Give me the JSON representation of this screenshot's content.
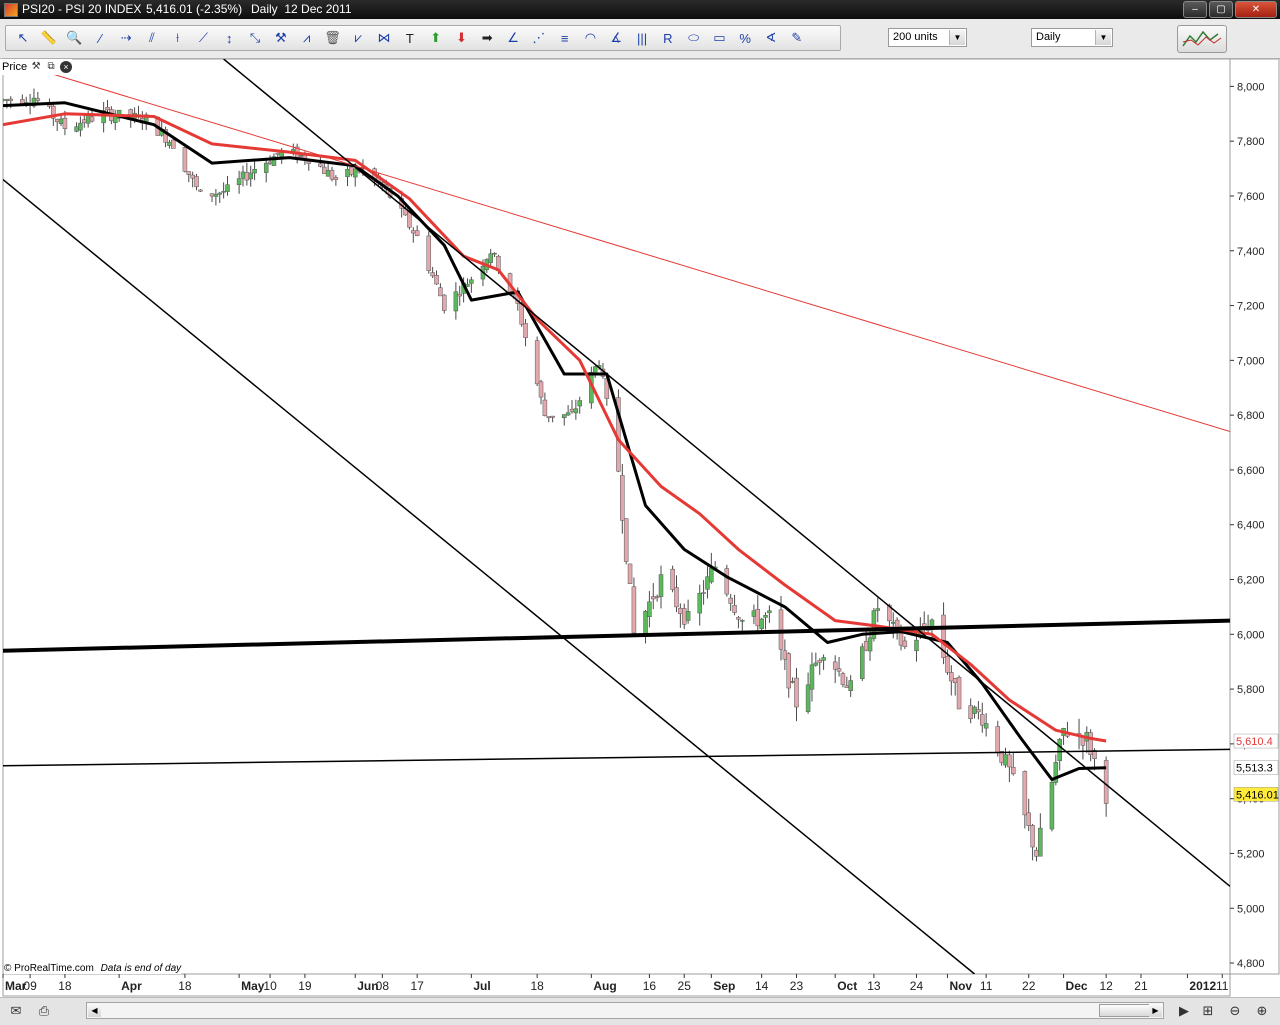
{
  "window": {
    "title_symbol": "PSI20 - PSI 20 INDEX",
    "title_price": "5,416.01 (-2.35%)",
    "title_period": "Daily  12 Dec 2011",
    "btn_minimize": "–",
    "btn_maximize": "▢",
    "btn_close": "✕"
  },
  "toolbar": {
    "tools": [
      {
        "icon": "pointer-icon",
        "glyph": "↖"
      },
      {
        "icon": "ruler-icon",
        "glyph": "📏"
      },
      {
        "icon": "zoom-icon",
        "glyph": "🔍"
      },
      {
        "icon": "line-icon",
        "glyph": "⁄"
      },
      {
        "icon": "horizontal-line-icon",
        "glyph": "⇢"
      },
      {
        "icon": "parallel-lines-icon",
        "glyph": "⫽"
      },
      {
        "icon": "vertical-line-icon",
        "glyph": "⟊"
      },
      {
        "icon": "trendline-icon",
        "glyph": "⟋"
      },
      {
        "icon": "vertical-arrow-icon",
        "glyph": "↕"
      },
      {
        "icon": "arrows-icon",
        "glyph": "⤡"
      },
      {
        "icon": "pitchfork-icon",
        "glyph": "⚒"
      },
      {
        "icon": "regression-icon",
        "glyph": "⩘"
      },
      {
        "icon": "trash-icon",
        "glyph": "🗑"
      },
      {
        "icon": "zigzag-icon",
        "glyph": "⩗"
      },
      {
        "icon": "triangles-icon",
        "glyph": "⋈"
      },
      {
        "icon": "text-icon",
        "glyph": "T"
      },
      {
        "icon": "up-arrow-icon",
        "glyph": "⬆"
      },
      {
        "icon": "down-arrow-icon",
        "glyph": "⬇"
      },
      {
        "icon": "right-arrow-icon",
        "glyph": "➡"
      },
      {
        "icon": "fan-6-icon",
        "glyph": "∠"
      },
      {
        "icon": "fan-icon",
        "glyph": "⋰"
      },
      {
        "icon": "fib-retracement-icon",
        "glyph": "≡"
      },
      {
        "icon": "fib-arc-icon",
        "glyph": "◠"
      },
      {
        "icon": "gann-icon",
        "glyph": "∡"
      },
      {
        "icon": "fib-time-icon",
        "glyph": "|||"
      },
      {
        "icon": "raff-channel-icon",
        "glyph": "R"
      },
      {
        "icon": "ellipse-icon",
        "glyph": "⬭"
      },
      {
        "icon": "rectangle-icon",
        "glyph": "▭"
      },
      {
        "icon": "percent-icon",
        "glyph": "%"
      },
      {
        "icon": "angle-icon",
        "glyph": "∢"
      },
      {
        "icon": "pencil-icon",
        "glyph": "✎"
      }
    ],
    "units_value": "200 units",
    "period_value": "Daily"
  },
  "panel": {
    "label": "Price",
    "wrench_glyph": "⚒",
    "copy_glyph": "⧉",
    "close_glyph": "×"
  },
  "footer": {
    "copyright": "© ProRealTime.com",
    "note": "Data is end of day"
  },
  "colors": {
    "up_candle": "#5cb85c",
    "down_candle": "#e3a8ad",
    "sma_fast": "#000000",
    "sma_slow": "#e53935",
    "last_price_bg": "#ffeb3b",
    "sma_slow_label": "#e53935"
  },
  "bottom": {
    "prev_glyph": "◀",
    "next_glyph": "▶",
    "mail_glyph": "✉",
    "print_glyph": "⎙",
    "zoom_fit_glyph": "⊞",
    "zoom_out_glyph": "⊖",
    "zoom_in_glyph": "⊕"
  },
  "chart_data": {
    "type": "candlestick",
    "symbol": "PSI20",
    "period": "Daily",
    "y_axis": {
      "ylim": [
        4760,
        8100
      ],
      "ticks": [
        "8,000",
        "7,800",
        "7,600",
        "7,400",
        "7,200",
        "7,000",
        "6,800",
        "6,600",
        "6,400",
        "6,200",
        "6,000",
        "5,800",
        "5,600",
        "5,400",
        "5,200",
        "5,000",
        "4,800"
      ],
      "tick_values": [
        8000,
        7800,
        7600,
        7400,
        7200,
        7000,
        6800,
        6600,
        6400,
        6200,
        6000,
        5800,
        5600,
        5400,
        5200,
        5000,
        4800
      ]
    },
    "price_labels": [
      {
        "text": "5,610.4",
        "value": 5610.4,
        "kind": "sma_slow"
      },
      {
        "text": "5,513.3",
        "value": 5513.3,
        "kind": "sma_fast"
      },
      {
        "text": "5,416.01",
        "value": 5416.01,
        "kind": "last"
      }
    ],
    "x_axis": {
      "start_date": "2011-03-02",
      "end_date": "2012-01-13",
      "ticks": [
        {
          "label": "Mar",
          "date": "2011-03-02",
          "major": true
        },
        {
          "label": "09",
          "date": "2011-03-09"
        },
        {
          "label": "18",
          "date": "2011-03-18"
        },
        {
          "label": "Apr",
          "date": "2011-04-01",
          "major": true
        },
        {
          "label": "18",
          "date": "2011-04-18"
        },
        {
          "label": "May",
          "date": "2011-05-02",
          "major": true
        },
        {
          "label": "10",
          "date": "2011-05-10"
        },
        {
          "label": "19",
          "date": "2011-05-19"
        },
        {
          "label": "Jun",
          "date": "2011-06-01",
          "major": true
        },
        {
          "label": "08",
          "date": "2011-06-08"
        },
        {
          "label": "17",
          "date": "2011-06-17"
        },
        {
          "label": "Jul",
          "date": "2011-07-01",
          "major": true
        },
        {
          "label": "18",
          "date": "2011-07-18"
        },
        {
          "label": "Aug",
          "date": "2011-08-01",
          "major": true
        },
        {
          "label": "16",
          "date": "2011-08-16"
        },
        {
          "label": "25",
          "date": "2011-08-25"
        },
        {
          "label": "Sep",
          "date": "2011-09-01",
          "major": true
        },
        {
          "label": "14",
          "date": "2011-09-14"
        },
        {
          "label": "23",
          "date": "2011-09-23"
        },
        {
          "label": "Oct",
          "date": "2011-10-03",
          "major": true
        },
        {
          "label": "13",
          "date": "2011-10-13"
        },
        {
          "label": "24",
          "date": "2011-10-24"
        },
        {
          "label": "Nov",
          "date": "2011-11-01",
          "major": true
        },
        {
          "label": "11",
          "date": "2011-11-11"
        },
        {
          "label": "22",
          "date": "2011-11-22"
        },
        {
          "label": "Dec",
          "date": "2011-12-01",
          "major": true
        },
        {
          "label": "12",
          "date": "2011-12-12"
        },
        {
          "label": "21",
          "date": "2011-12-21"
        },
        {
          "label": "2012",
          "date": "2012-01-02",
          "major": true
        },
        {
          "label": "11",
          "date": "2012-01-11"
        }
      ]
    },
    "price_path": [
      [
        "2011-03-02",
        7950
      ],
      [
        "2011-03-10",
        7960
      ],
      [
        "2011-03-18",
        7850
      ],
      [
        "2011-03-28",
        7900
      ],
      [
        "2011-04-08",
        7880
      ],
      [
        "2011-04-15",
        7790
      ],
      [
        "2011-04-22",
        7600
      ],
      [
        "2011-04-29",
        7620
      ],
      [
        "2011-05-06",
        7700
      ],
      [
        "2011-05-13",
        7760
      ],
      [
        "2011-05-20",
        7740
      ],
      [
        "2011-05-27",
        7660
      ],
      [
        "2011-06-03",
        7700
      ],
      [
        "2011-06-10",
        7600
      ],
      [
        "2011-06-17",
        7450
      ],
      [
        "2011-06-24",
        7200
      ],
      [
        "2011-07-01",
        7300
      ],
      [
        "2011-07-06",
        7400
      ],
      [
        "2011-07-13",
        7200
      ],
      [
        "2011-07-20",
        6800
      ],
      [
        "2011-07-27",
        6800
      ],
      [
        "2011-08-03",
        7000
      ],
      [
        "2011-08-08",
        6600
      ],
      [
        "2011-08-12",
        6000
      ],
      [
        "2011-08-19",
        6200
      ],
      [
        "2011-08-26",
        6050
      ],
      [
        "2011-09-02",
        6250
      ],
      [
        "2011-09-09",
        6050
      ],
      [
        "2011-09-16",
        6060
      ],
      [
        "2011-09-23",
        5750
      ],
      [
        "2011-09-30",
        5950
      ],
      [
        "2011-10-07",
        5800
      ],
      [
        "2011-10-14",
        6100
      ],
      [
        "2011-10-21",
        5950
      ],
      [
        "2011-10-28",
        6050
      ],
      [
        "2011-11-04",
        5750
      ],
      [
        "2011-11-10",
        5700
      ],
      [
        "2011-11-17",
        5500
      ],
      [
        "2011-11-24",
        5200
      ],
      [
        "2011-12-01",
        5650
      ],
      [
        "2011-12-07",
        5620
      ],
      [
        "2011-12-12",
        5416
      ]
    ],
    "series": [
      {
        "kind": "sma_fast",
        "color": "#000000",
        "x": [
          "2011-03-02",
          "2011-03-18",
          "2011-04-10",
          "2011-04-25",
          "2011-05-15",
          "2011-06-01",
          "2011-06-12",
          "2011-06-24",
          "2011-07-01",
          "2011-07-13",
          "2011-07-25",
          "2011-08-05",
          "2011-08-15",
          "2011-08-25",
          "2011-09-05",
          "2011-09-20",
          "2011-10-01",
          "2011-10-10",
          "2011-10-20",
          "2011-11-01",
          "2011-11-10",
          "2011-11-20",
          "2011-11-28",
          "2011-12-05",
          "2011-12-12"
        ],
        "y": [
          7930,
          7940,
          7860,
          7720,
          7740,
          7710,
          7600,
          7420,
          7220,
          7250,
          6950,
          6950,
          6470,
          6310,
          6210,
          6100,
          5970,
          6000,
          6010,
          5970,
          5820,
          5620,
          5470,
          5510,
          5513
        ]
      },
      {
        "kind": "sma_slow",
        "color": "#e53935",
        "x": [
          "2011-03-02",
          "2011-03-18",
          "2011-04-10",
          "2011-04-25",
          "2011-05-15",
          "2011-06-01",
          "2011-06-15",
          "2011-06-29",
          "2011-07-08",
          "2011-07-18",
          "2011-07-29",
          "2011-08-08",
          "2011-08-19",
          "2011-08-29",
          "2011-09-08",
          "2011-09-20",
          "2011-10-03",
          "2011-10-14",
          "2011-10-28",
          "2011-11-07",
          "2011-11-17",
          "2011-11-29",
          "2011-12-08",
          "2011-12-12"
        ],
        "y": [
          7860,
          7900,
          7890,
          7790,
          7760,
          7730,
          7590,
          7380,
          7330,
          7150,
          7000,
          6710,
          6540,
          6440,
          6310,
          6180,
          6050,
          6030,
          6000,
          5890,
          5760,
          5650,
          5620,
          5610.4
        ]
      }
    ],
    "trendlines": [
      {
        "name": "long-term-resistance",
        "color": "#e53935",
        "width": 1,
        "p1": [
          "2011-03-02",
          8100
        ],
        "p2": [
          "2012-01-13",
          6740
        ]
      },
      {
        "name": "channel-upper",
        "color": "#000000",
        "width": 1.5,
        "p1": [
          "2011-04-28",
          8100
        ],
        "p2": [
          "2012-01-13",
          5080
        ]
      },
      {
        "name": "channel-lower",
        "color": "#000000",
        "width": 1.5,
        "p1": [
          "2011-03-02",
          7660
        ],
        "p2": [
          "2011-11-08",
          4760
        ]
      },
      {
        "name": "support-6000",
        "color": "#000000",
        "width": 4,
        "p1": [
          "2011-03-02",
          5940
        ],
        "p2": [
          "2012-01-13",
          6050
        ]
      },
      {
        "name": "support-5560",
        "color": "#000000",
        "width": 1.5,
        "p1": [
          "2011-03-02",
          5520
        ],
        "p2": [
          "2012-01-13",
          5580
        ]
      }
    ]
  }
}
